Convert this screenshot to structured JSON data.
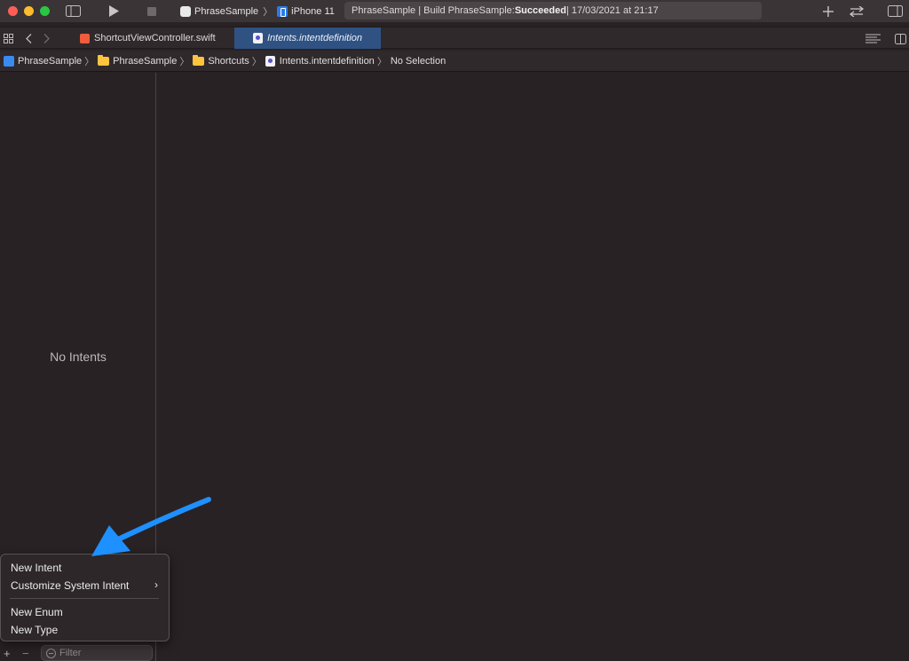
{
  "toolbar": {
    "scheme_name": "PhraseSample",
    "device_name": "iPhone 11",
    "activity_prefix": "PhraseSample | Build PhraseSample: ",
    "activity_status": "Succeeded",
    "activity_time": " | 17/03/2021 at 21:17",
    "icons": [
      "sidebar-toggle-icon",
      "run-icon",
      "stop-icon",
      "add-icon",
      "code-review-icon",
      "inspector-toggle-icon"
    ]
  },
  "tabs": [
    {
      "label": "ShortcutViewController.swift",
      "active": false
    },
    {
      "label": "Intents.intentdefinition",
      "active": true
    }
  ],
  "breadcrumb": {
    "items": [
      "PhraseSample",
      "PhraseSample",
      "Shortcuts",
      "Intents.intentdefinition",
      "No Selection"
    ]
  },
  "sidebar": {
    "empty_label": "No Intents",
    "filter_placeholder": "Filter",
    "add_label": "+",
    "remove_label": "−"
  },
  "menu": {
    "items": [
      "New Intent",
      "Customize System Intent",
      "New Enum",
      "New Type"
    ],
    "submenu_arrow": "›"
  },
  "colors": {
    "background": "#282224",
    "active_tab": "#2f5283",
    "annotation_arrow": "#1e90ff"
  }
}
